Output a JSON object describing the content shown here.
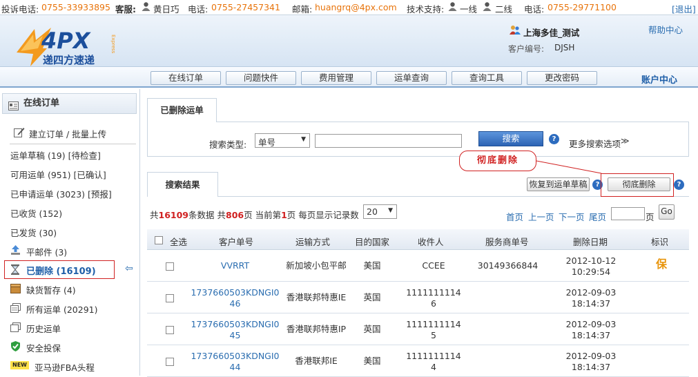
{
  "topbar": {
    "complaint_label": "投诉电话:",
    "complaint_phone": "0755-33933895",
    "service_label": "客服:",
    "service_name": "黄日巧",
    "phone_label": "电话:",
    "service_phone": "0755-27457341",
    "email_label": "邮箱:",
    "email": "huangrq@4px.com",
    "tech_label": "技术支持:",
    "line1": "一线",
    "line2": "二线",
    "phone_label2": "电话:",
    "tech_phone": "0755-29771100",
    "logout": "[退出]"
  },
  "header": {
    "logo_text": "4PX",
    "logo_cn": "递四方速递",
    "logo_en": "Express",
    "company": "上海多佳_测试",
    "client_code_label": "客户编号:",
    "client_code": "DJSH",
    "help": "帮助中心"
  },
  "nav": {
    "items": [
      "在线订单",
      "问题快件",
      "费用管理",
      "运单查询",
      "查询工具",
      "更改密码"
    ],
    "account": "账户中心"
  },
  "sidebar": {
    "title": "在线订单",
    "create": "建立订单 / 批量上传",
    "items": [
      "运单草稿 (19) [待检查]",
      "可用运单 (951) [已确认]",
      "已申请运单 (3023) [预报]",
      "已收货 (152)",
      "已发货 (30)",
      "平邮件 (3)",
      "已删除 (16109)",
      "缺货暂存 (4)",
      "所有运单 (20291)",
      "历史运单",
      "安全投保",
      "亚马逊FBA头程"
    ],
    "new_badge": "NEW",
    "arrow": "⇦"
  },
  "main": {
    "top_tab": "已删除运单",
    "search_type_label": "搜索类型:",
    "search_type_value": "单号",
    "search_input_value": "",
    "search_button": "搜索",
    "more_options": "更多搜索选项",
    "annotation": "彻底删除",
    "results_tab": "搜索结果",
    "restore_button": "恢复到运单草稿",
    "delete_button": "彻底删除",
    "help_glyph": "?",
    "summary_pre": "共",
    "total_records": "16109",
    "summary_mid1": "条数据 共",
    "total_pages": "806",
    "summary_mid2": "页 当前第",
    "current_page": "1",
    "summary_mid3": "页 每页显示记录数",
    "per_page": "20",
    "pager": [
      "首页",
      "上一页",
      "下一页",
      "尾页"
    ],
    "page_input_value": "",
    "page_suffix": "页",
    "go": "Go"
  },
  "table": {
    "columns": [
      "全选",
      "客户单号",
      "运输方式",
      "目的国家",
      "收件人",
      "服务商单号",
      "删除日期",
      "标识"
    ],
    "rows": [
      {
        "order": "VVRRT",
        "order2": "",
        "method": "新加坡小包平邮",
        "country": "美国",
        "recipient": "CCEE",
        "recipient2": "",
        "provider": "30149366844",
        "date": "2012-10-12",
        "time": "10:29:54",
        "mark": "保"
      },
      {
        "order": "1737660503KDNGI0",
        "order2": "46",
        "method": "香港联邦特惠IE",
        "country": "英国",
        "recipient": "1111111114",
        "recipient2": "6",
        "provider": "",
        "date": "2012-09-03",
        "time": "18:14:37",
        "mark": ""
      },
      {
        "order": "1737660503KDNGI0",
        "order2": "45",
        "method": "香港联邦特惠IP",
        "country": "英国",
        "recipient": "1111111114",
        "recipient2": "5",
        "provider": "",
        "date": "2012-09-03",
        "time": "18:14:37",
        "mark": ""
      },
      {
        "order": "1737660503KDNGI0",
        "order2": "44",
        "method": "香港联邦IE",
        "country": "美国",
        "recipient": "1111111114",
        "recipient2": "4",
        "provider": "",
        "date": "2012-09-03",
        "time": "18:14:37",
        "mark": ""
      }
    ]
  },
  "colors": {
    "accent": "#e8730a",
    "link": "#2a6db0",
    "red": "#d02020",
    "button_blue": "#2d6cbf"
  }
}
